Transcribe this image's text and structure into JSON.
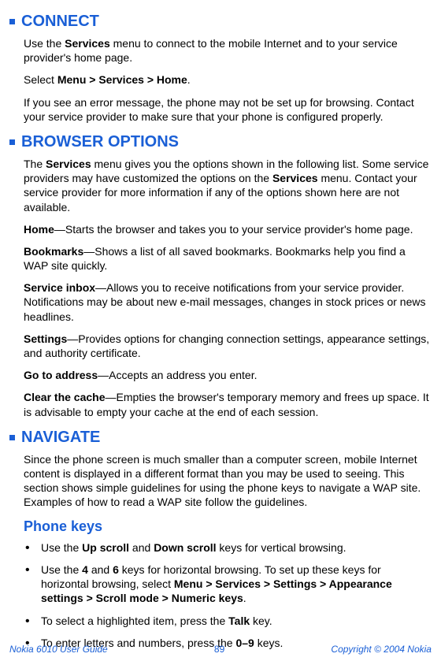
{
  "sections": {
    "connect": {
      "heading": "CONNECT",
      "p1a": "Use the ",
      "p1b": "Services",
      "p1c": " menu to connect to the mobile Internet and to your service provider's home page.",
      "p2a": "Select ",
      "p2b": "Menu > Services > Home",
      "p2c": ".",
      "p3": "If you see an error message, the phone may not be set up for browsing. Contact your service provider to make sure that your phone is configured properly."
    },
    "browser": {
      "heading": "BROWSER OPTIONS",
      "intro_a": "The ",
      "intro_b": "Services",
      "intro_c": " menu gives you the options shown in the following list. Some service providers may have customized the options on the ",
      "intro_d": "Services",
      "intro_e": " menu. Contact your service provider for more information if any of the options shown here are not available.",
      "home_b": "Home",
      "home_t": "—Starts the browser and takes you to your service provider's home page.",
      "bm_b": "Bookmarks",
      "bm_t": "—Shows a list of all saved bookmarks. Bookmarks help you find a WAP site quickly.",
      "si_b": "Service inbox",
      "si_t": "—Allows you to receive notifications from your service provider. Notifications may be about new e-mail messages, changes in stock prices or news headlines.",
      "set_b": "Settings",
      "set_t": "—Provides options for changing connection settings, appearance settings, and authority certificate.",
      "ga_b": "Go to address",
      "ga_t": "—Accepts an address you enter.",
      "cc_b": "Clear the cache",
      "cc_t": "—Empties the browser's temporary memory and frees up space. It is advisable to empty your cache at the end of each session."
    },
    "navigate": {
      "heading": "NAVIGATE",
      "intro": "Since the phone screen is much smaller than a computer screen, mobile Internet content is displayed in a different format than you may be used to seeing. This section shows simple guidelines for using the phone keys to navigate a WAP site. Examples of how to read a WAP site follow the guidelines.",
      "sub": "Phone keys",
      "li1_a": "Use the ",
      "li1_b": "Up scroll",
      "li1_c": " and ",
      "li1_d": "Down scroll",
      "li1_e": " keys for vertical browsing.",
      "li2_a": "Use the ",
      "li2_b": "4",
      "li2_c": " and ",
      "li2_d": "6",
      "li2_e": " keys for horizontal browsing. To set up these keys for horizontal browsing, select ",
      "li2_f": "Menu > Services > Settings > Appearance settings > Scroll mode > Numeric keys",
      "li2_g": ".",
      "li3_a": "To select a highlighted item, press the ",
      "li3_b": "Talk",
      "li3_c": " key.",
      "li4_a": "To enter letters and numbers, press the ",
      "li4_b": "0–9",
      "li4_c": " keys."
    }
  },
  "footer": {
    "left": "Nokia 6010 User Guide",
    "page": "89",
    "right": "Copyright © 2004 Nokia"
  }
}
